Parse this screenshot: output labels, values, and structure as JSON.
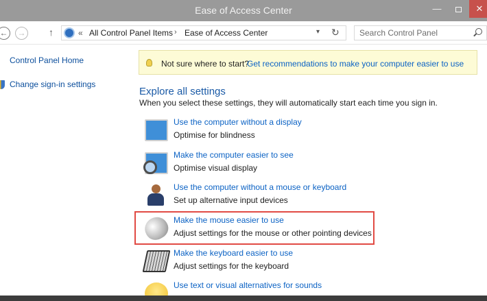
{
  "window": {
    "title": "Ease of Access Center",
    "minimize_label": "—",
    "close_label": "✕"
  },
  "nav": {
    "back_glyph": "←",
    "forward_glyph": "→",
    "up_glyph": "↑",
    "overflow_glyph": "«",
    "breadcrumb": [
      "All Control Panel Items",
      "Ease of Access Center"
    ],
    "breadcrumb_separator": "›",
    "dropdown_glyph": "▾",
    "refresh_glyph": "↻",
    "search_placeholder": "Search Control Panel"
  },
  "left_pane": {
    "links": [
      {
        "label": "Control Panel Home"
      },
      {
        "label": "Change sign-in settings",
        "icon": "shield-icon"
      }
    ]
  },
  "tip": {
    "text": "Not sure where to start?",
    "link": "Get recommendations to make your computer easier to use"
  },
  "main": {
    "heading": "Explore all settings",
    "subtext": "When you select these settings, they will automatically start each time you sign in.",
    "items": [
      {
        "title": "Use the computer without a display",
        "desc": "Optimise for blindness",
        "icon": "monitor-icon"
      },
      {
        "title": "Make the computer easier to see",
        "desc": "Optimise visual display",
        "icon": "magnifier-icon"
      },
      {
        "title": "Use the computer without a mouse or keyboard",
        "desc": "Set up alternative input devices",
        "icon": "person-icon"
      },
      {
        "title": "Make the mouse easier to use",
        "desc": "Adjust settings for the mouse or other pointing devices",
        "icon": "mouse-icon",
        "highlighted": true
      },
      {
        "title": "Make the keyboard easier to use",
        "desc": "Adjust settings for the keyboard",
        "icon": "keyboard-icon"
      },
      {
        "title": "Use text or visual alternatives for sounds",
        "desc": "",
        "icon": "sound-icon"
      }
    ]
  },
  "colors": {
    "link": "#0b62c4",
    "heading": "#1a5aa6",
    "titlebar": "#9a9a9a",
    "close": "#c7514c",
    "highlight": "#e14a43",
    "tip_bg": "#fdfbd6"
  }
}
